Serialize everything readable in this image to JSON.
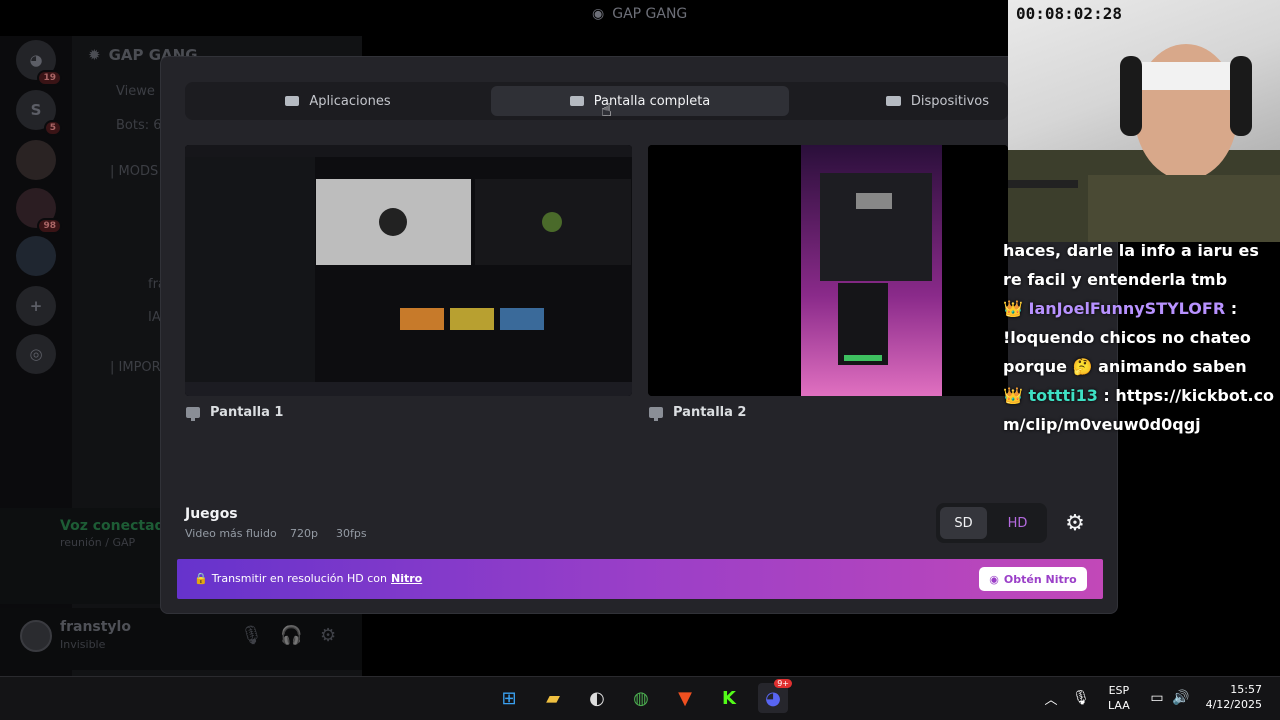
{
  "window": {
    "title": "GAP GANG"
  },
  "server_rail": {
    "badges": [
      "19",
      "5",
      "98"
    ]
  },
  "server": {
    "name": "GAP GANG",
    "channels": [
      "Viewe",
      "Bots: 6",
      "| MODS",
      "| IMPOR"
    ],
    "voice_members": [
      "fra",
      "IA"
    ]
  },
  "voice": {
    "status": "Voz conectada",
    "channel": "reunión / GAP"
  },
  "user": {
    "name": "franstylo",
    "status": "Invisible"
  },
  "modal": {
    "tabs": [
      {
        "label": "Aplicaciones",
        "icon": "window-icon"
      },
      {
        "label": "Pantalla completa",
        "icon": "monitor-icon"
      },
      {
        "label": "Dispositivos",
        "icon": "camera-icon"
      }
    ],
    "screens": [
      {
        "label": "Pantalla 1",
        "icon": "monitor-icon"
      },
      {
        "label": "Pantalla 2",
        "icon": "monitor-icon"
      }
    ],
    "games": {
      "title": "Juegos",
      "subtitle": "Video más fluido",
      "resolution": "720p",
      "fps": "30fps"
    },
    "quality": {
      "sd": "SD",
      "hd": "HD",
      "selected": "SD"
    },
    "banner": {
      "text": "Transmitir en resolución HD con",
      "link": "Nitro",
      "button": "Obtén Nitro"
    }
  },
  "stream": {
    "timer": "00:08:02:28",
    "chat": [
      {
        "user": "",
        "text": "haces, darle la info a iaru es re facil y entenderla tmb"
      },
      {
        "user": "IanJoelFunnySTYLOFR",
        "text": "!loquendo chicos no chateo porque 🤔 animando saben"
      },
      {
        "user": "tottti13",
        "text": "https://kickbot.com/clip/m0veuw0d0qgj"
      }
    ]
  },
  "taskbar": {
    "apps": [
      "windows-start",
      "file-explorer",
      "obs",
      "chrome",
      "brave",
      "kick",
      "discord"
    ],
    "discord_badge": "9+",
    "lang": "ESP",
    "layout": "LAA",
    "time": "15:57",
    "date": "4/12/2025"
  },
  "colors": {
    "nitro_start": "#6633cc",
    "nitro_end": "#c248b8",
    "hd_accent": "#b46adf",
    "voice_green": "#1d5c35"
  }
}
